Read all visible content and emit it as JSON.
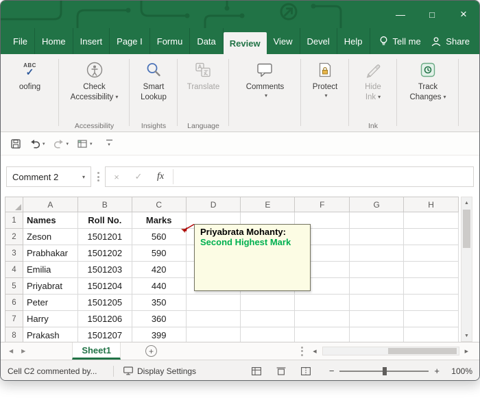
{
  "icons": {
    "minimize": "—",
    "maximize": "□",
    "close": "×",
    "caret": "▾",
    "cancel": "×",
    "enter": "✓",
    "abc": "ABC",
    "check": "✓",
    "plus": "+",
    "scroll_up": "▲",
    "scroll_down": "▼",
    "scroll_left": "◀",
    "scroll_right": "▶",
    "zoom_out": "−",
    "zoom_in": "+"
  },
  "ribbon": {
    "tabs": [
      "File",
      "Home",
      "Insert",
      "Page I",
      "Formu",
      "Data",
      "Review",
      "View",
      "Devel",
      "Help"
    ],
    "active_tab": "Review",
    "tell_me": "Tell me",
    "share": "Share",
    "buttons": {
      "proofing_partial": "oofing",
      "check_accessibility": [
        "Check",
        "Accessibility"
      ],
      "smart_lookup": [
        "Smart",
        "Lookup"
      ],
      "translate": "Translate",
      "comments": "Comments",
      "protect": "Protect",
      "hide_ink": [
        "Hide",
        "Ink"
      ],
      "track_changes": [
        "Track",
        "Changes"
      ]
    },
    "group_labels": {
      "accessibility": "Accessibility",
      "insights": "Insights",
      "language": "Language",
      "ink": "Ink"
    }
  },
  "name_box": {
    "value": "Comment 2"
  },
  "formula_bar": {
    "fx": "fx",
    "value": ""
  },
  "grid": {
    "columns": [
      "A",
      "B",
      "C",
      "D",
      "E",
      "F",
      "G",
      "H"
    ],
    "rows": [
      {
        "num": "1",
        "a": "Names",
        "b": "Roll No.",
        "c": "Marks"
      },
      {
        "num": "2",
        "a": "Zeson",
        "b": "1501201",
        "c": "560"
      },
      {
        "num": "3",
        "a": "Prabhakar",
        "b": "1501202",
        "c": "590"
      },
      {
        "num": "4",
        "a": "Emilia",
        "b": "1501203",
        "c": "420"
      },
      {
        "num": "5",
        "a": "Priyabrat",
        "b": "1501204",
        "c": "440"
      },
      {
        "num": "6",
        "a": "Peter",
        "b": "1501205",
        "c": "350"
      },
      {
        "num": "7",
        "a": "Harry",
        "b": "1501206",
        "c": "360"
      },
      {
        "num": "8",
        "a": "Prakash",
        "b": "1501207",
        "c": "399"
      }
    ]
  },
  "comment": {
    "author": "Priyabrata Mohanty:",
    "body": "Second Highest Mark"
  },
  "sheet_tabs": {
    "active": "Sheet1"
  },
  "status_bar": {
    "left_text": "Cell C2 commented by...",
    "display_settings": "Display Settings",
    "zoom_level": "100%"
  },
  "colors": {
    "excel_green": "#217346",
    "titlebar_pattern": "#1a6138",
    "comment_bg": "#fcfce4",
    "comment_text_green": "#00b050",
    "arrow_red": "#b00000"
  }
}
